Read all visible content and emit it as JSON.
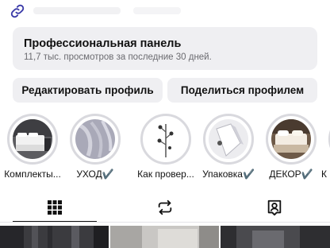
{
  "profile_link": {
    "icon": "link-icon"
  },
  "dashboard": {
    "title": "Профессиональная панель",
    "subtitle": "11,7 тыс. просмотров за последние 30 дней."
  },
  "buttons": {
    "edit_profile": "Редактировать профиль",
    "share_profile": "Поделиться профилем"
  },
  "highlights": [
    {
      "label": "Комплекты..."
    },
    {
      "label": "УХОД✔️"
    },
    {
      "label": "Как провер..."
    },
    {
      "label": "Упаковка✔️"
    },
    {
      "label": "ДЕКОР✔️"
    },
    {
      "label": "К"
    }
  ],
  "tabs": [
    {
      "icon": "grid-icon",
      "active": true
    },
    {
      "icon": "reels-icon",
      "active": false
    },
    {
      "icon": "tagged-icon",
      "active": false
    }
  ],
  "colors": {
    "panel_bg": "#efeff2",
    "ring": "#d9d9de",
    "text": "#111111",
    "muted": "#6b6b70"
  }
}
